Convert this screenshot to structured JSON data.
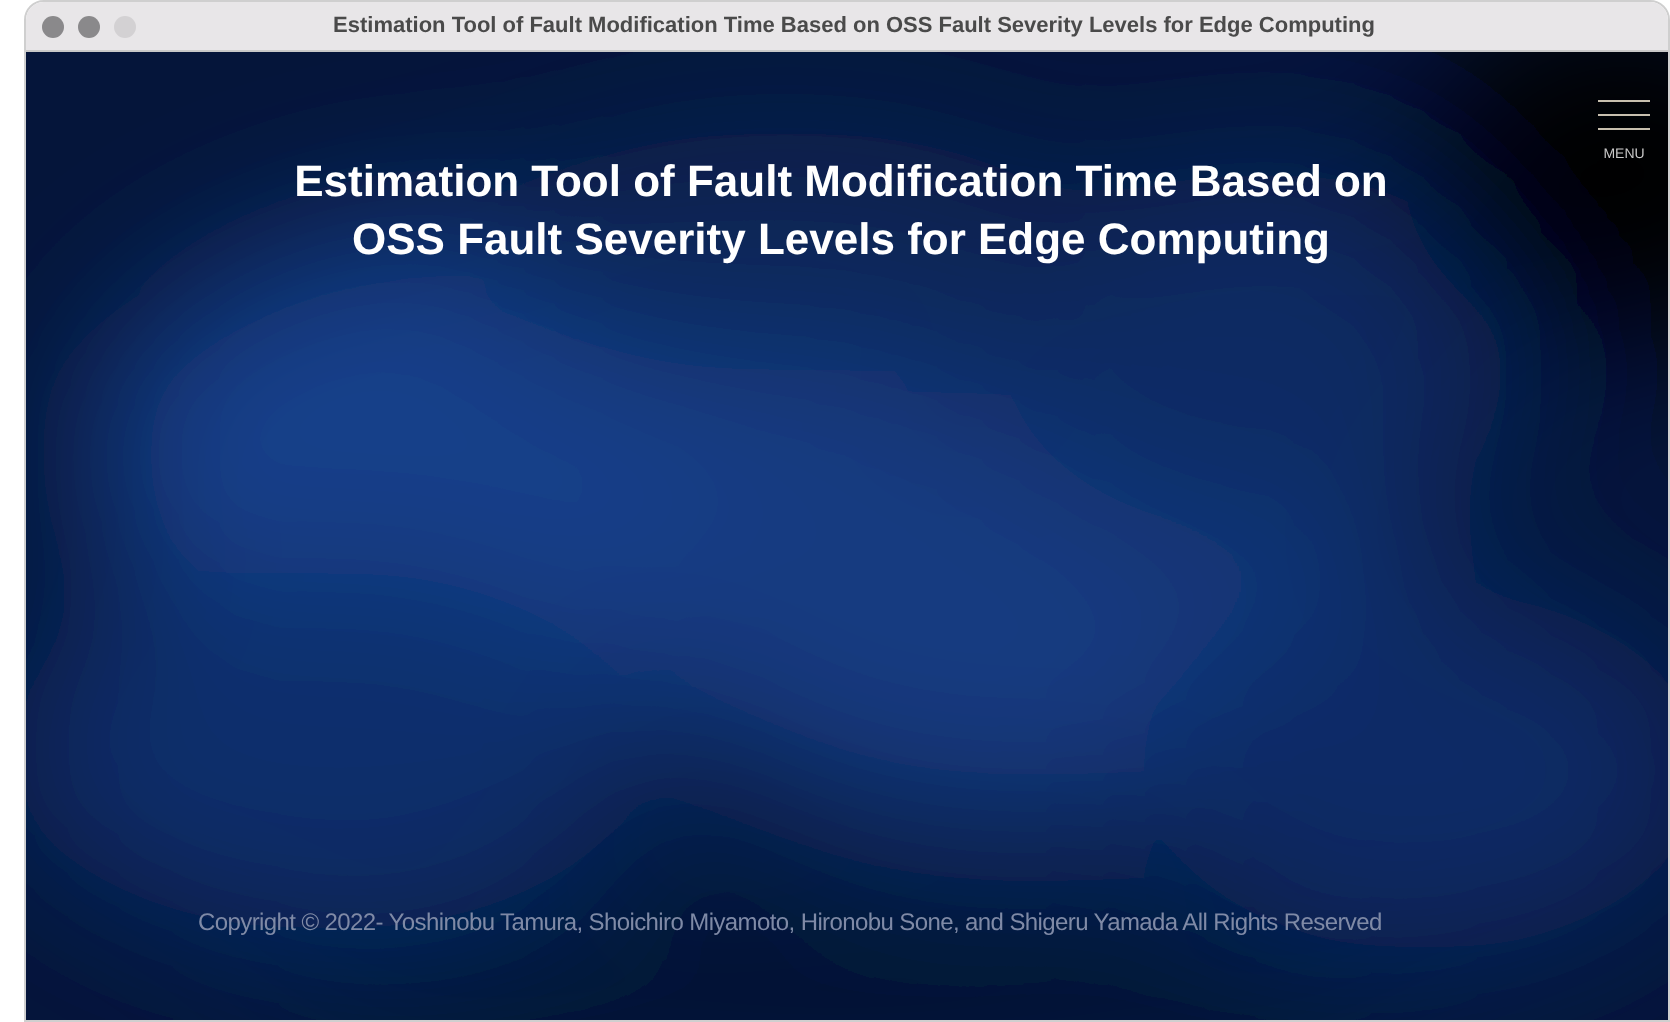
{
  "window": {
    "title": "Estimation Tool of Fault Modification Time Based on OSS Fault Severity Levels for Edge Computing"
  },
  "hero": {
    "kind": "picture",
    "heading_lines": [
      "Estimation Tool of Fault Modification Time Based on",
      "OSS Fault Severity Levels for Edge Computing"
    ]
  },
  "menu": {
    "label": "MENU"
  },
  "footer": {
    "copyright": "Copyright ©   2022- Yoshinobu Tamura, Shoichiro Miyamoto, Hironobu Sone, and Shigeru Yamada All Rights Reserved"
  }
}
